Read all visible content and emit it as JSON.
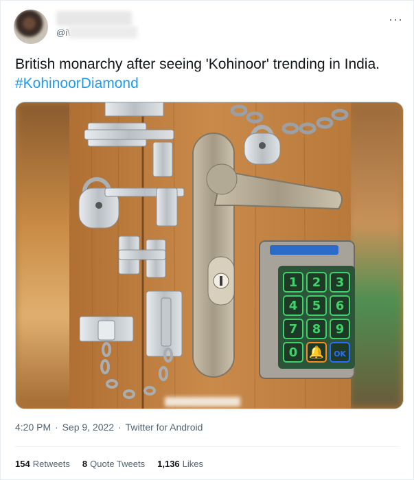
{
  "header": {
    "handle_prefix": "@i\\",
    "more_glyph": "···"
  },
  "tweet": {
    "text": "British monarchy after seeing 'Kohinoor' trending in India. ",
    "hashtag": "#KohinoorDiamond"
  },
  "meta": {
    "time": "4:20 PM",
    "sep1": " · ",
    "date": "Sep 9, 2022",
    "sep2": " · ",
    "source": "Twitter for Android"
  },
  "stats": {
    "retweets_count": "154",
    "retweets_label": "Retweets",
    "quotes_count": "8",
    "quotes_label": "Quote Tweets",
    "likes_count": "1,136",
    "likes_label": "Likes"
  },
  "keypad": {
    "keys": [
      "1",
      "2",
      "3",
      "4",
      "5",
      "6",
      "7",
      "8",
      "9",
      "0",
      "🔔",
      "OK"
    ],
    "key_color": "#3fd16a",
    "bell_color": "#ff8a1e",
    "ok_color": "#2a6cff"
  },
  "image": {
    "icon": "locks-door-image"
  }
}
